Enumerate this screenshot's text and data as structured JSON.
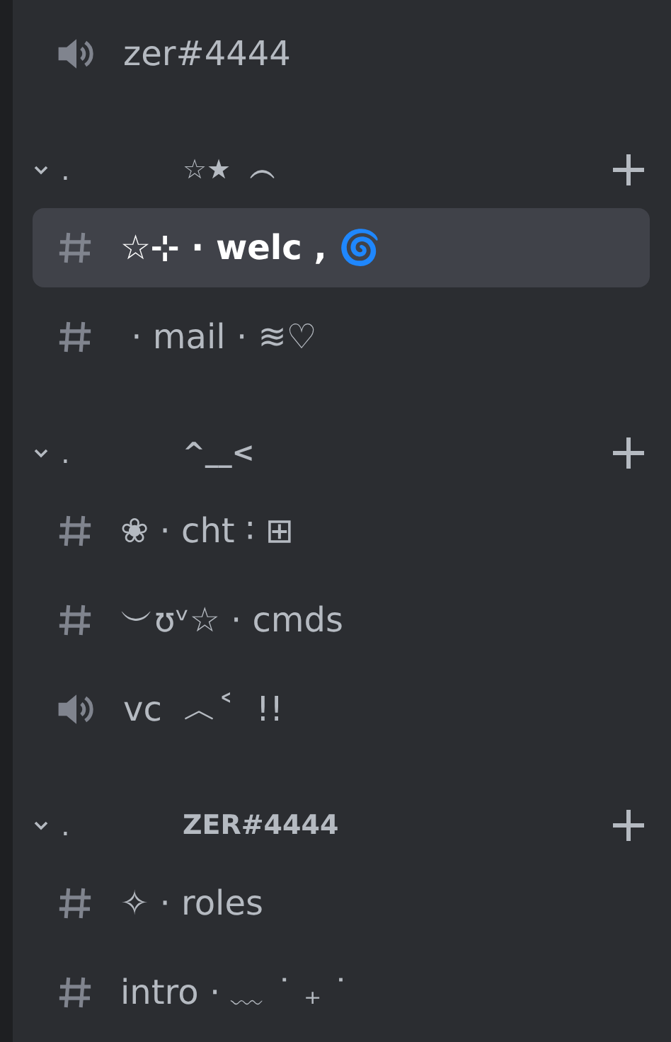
{
  "top_channel": {
    "kind": "voice",
    "name": "zer#4444",
    "selected": false
  },
  "categories": [
    {
      "prefix": ".",
      "name": "☆★  ︵",
      "expanded": true,
      "channels": [
        {
          "kind": "text",
          "name": "☆⊹ · welc , 🌀",
          "selected": true
        },
        {
          "kind": "text",
          "name": " · mail · ≋♡",
          "selected": false
        }
      ]
    },
    {
      "prefix": ".",
      "name": "^__<",
      "expanded": true,
      "channels": [
        {
          "kind": "text",
          "name": "❀ · cht ∶ ⊞",
          "selected": false
        },
        {
          "kind": "text",
          "name": "︶ʊᵛ☆ · cmds",
          "selected": false
        },
        {
          "kind": "voice",
          "name": "vc  ︿˂  !!",
          "selected": false
        }
      ]
    },
    {
      "prefix": ".",
      "name": "ZER#4444",
      "expanded": true,
      "channels": [
        {
          "kind": "text",
          "name": "✧ · roles",
          "selected": false
        },
        {
          "kind": "text",
          "name": "intro · ﹏ ˙ ₊ ˙",
          "selected": false
        }
      ]
    }
  ]
}
